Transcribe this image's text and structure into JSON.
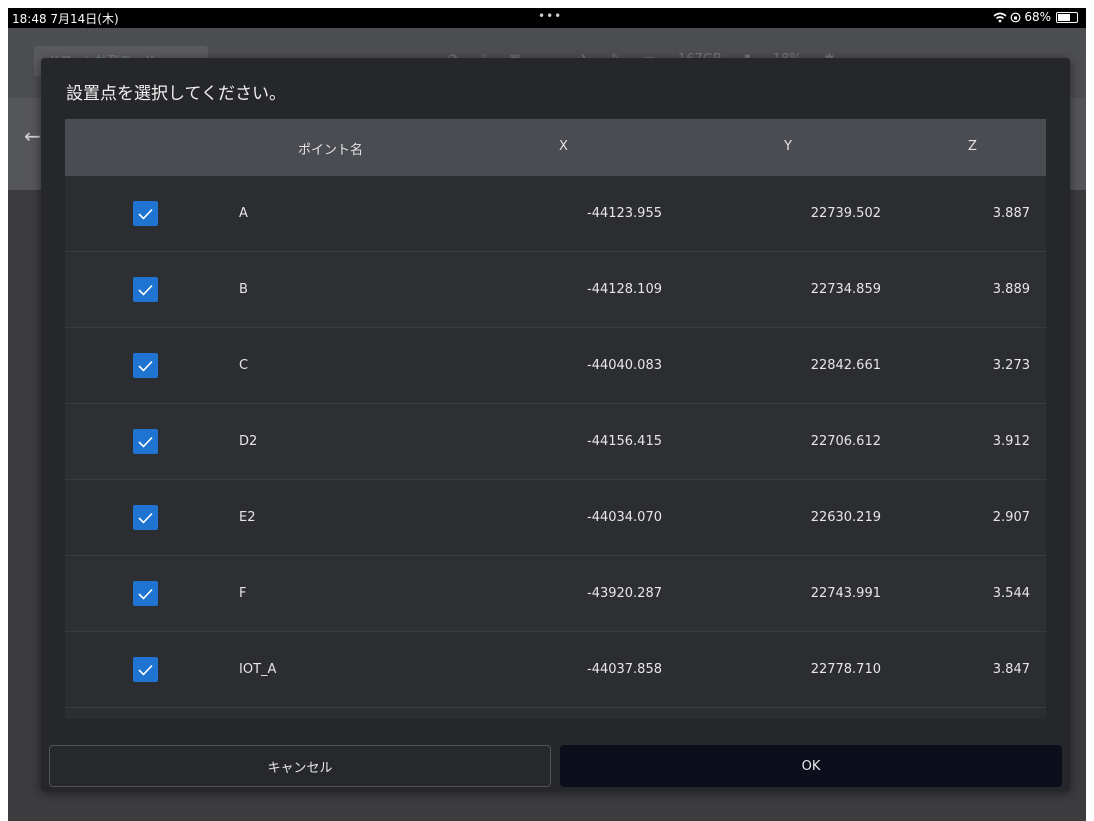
{
  "status": {
    "time_date": "18:48  7月14日(木)",
    "dots": "•••",
    "battery": "68%",
    "battery_level": 0.68
  },
  "appbar": {
    "mode_label": "ドローン計測モード ▾",
    "storage": "167GB",
    "percent": "18%"
  },
  "dialog": {
    "title": "設置点を選択してください。",
    "columns": {
      "name": "ポイント名",
      "x": "X",
      "y": "Y",
      "z": "Z"
    },
    "rows": [
      {
        "name": "A",
        "x": "-44123.955",
        "y": "22739.502",
        "z": "3.887",
        "checked": true
      },
      {
        "name": "B",
        "x": "-44128.109",
        "y": "22734.859",
        "z": "3.889",
        "checked": true
      },
      {
        "name": "C",
        "x": "-44040.083",
        "y": "22842.661",
        "z": "3.273",
        "checked": true
      },
      {
        "name": "D2",
        "x": "-44156.415",
        "y": "22706.612",
        "z": "3.912",
        "checked": true
      },
      {
        "name": "E2",
        "x": "-44034.070",
        "y": "22630.219",
        "z": "2.907",
        "checked": true
      },
      {
        "name": "F",
        "x": "-43920.287",
        "y": "22743.991",
        "z": "3.544",
        "checked": true
      },
      {
        "name": "IOT_A",
        "x": "-44037.858",
        "y": "22778.710",
        "z": "3.847",
        "checked": true
      }
    ],
    "cancel_label": "キャンセル",
    "ok_label": "OK"
  },
  "colors": {
    "checkbox": "#1f73d1",
    "dialog_bg": "#26272b",
    "header_bg": "#4a4c52",
    "ok_bg": "#0d0e1c"
  }
}
